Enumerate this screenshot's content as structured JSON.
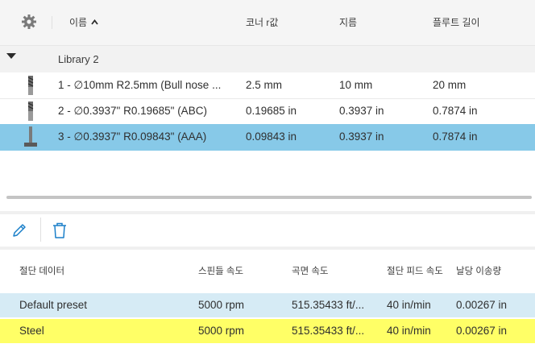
{
  "header": {
    "settings_icon": "gear-icon",
    "name": "이름",
    "sort_indicator": "^",
    "corner_radius": "코너 r값",
    "diameter": "지름",
    "flute_length": "플루트 길이"
  },
  "library": {
    "label": "Library 2",
    "expanded": true
  },
  "tools": [
    {
      "icon": "bull-nose-endmill-icon",
      "name": "1 - ∅10mm R2.5mm (Bull nose ...",
      "corner": "2.5 mm",
      "diameter": "10 mm",
      "flute": "20 mm",
      "selected": false
    },
    {
      "icon": "bull-nose-endmill-icon",
      "name": "2 - ∅0.3937\" R0.19685\" (ABC)",
      "corner": "0.19685 in",
      "diameter": "0.3937 in",
      "flute": "0.7874 in",
      "selected": false
    },
    {
      "icon": "t-slot-cutter-icon",
      "name": "3 - ∅0.3937\" R0.09843\" (AAA)",
      "corner": "0.09843 in",
      "diameter": "0.3937 in",
      "flute": "0.7874 in",
      "selected": true
    }
  ],
  "toolbar": {
    "edit_icon": "pencil-icon",
    "delete_icon": "trash-icon"
  },
  "cutting_data": {
    "headers": {
      "name": "절단 데이터",
      "spindle": "스핀들 속도",
      "surface": "곡면 속도",
      "feed": "절단 피드 속도",
      "chip": "날당 이송량"
    },
    "rows": [
      {
        "name": "Default preset",
        "spindle": "5000 rpm",
        "surface": "515.35433 ft/...",
        "feed": "40 in/min",
        "chip": "0.00267 in",
        "bg": "#d6ebf5"
      },
      {
        "name": "Steel",
        "spindle": "5000 rpm",
        "surface": "515.35433 ft/...",
        "feed": "40 in/min",
        "chip": "0.00267 in",
        "bg": "#ffff66"
      }
    ]
  },
  "colors": {
    "selected_row": "#87c9e8",
    "accent": "#1a7fc9"
  }
}
